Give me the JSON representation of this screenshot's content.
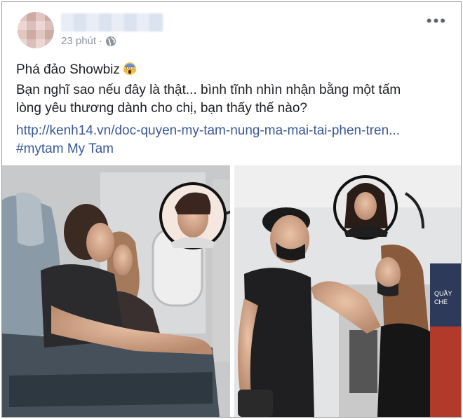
{
  "post": {
    "time": "23 phút",
    "separator": "·",
    "line1": "Phá đảo Showbiz",
    "line2": "Bạn nghĩ sao nếu đây là thật... bình tĩnh nhìn nhận bằng một tấm",
    "line3": "lòng yêu thương dành cho chị, bạn thấy thế nào?",
    "link": "http://kenh14.vn/doc-quyen-my-tam-nung-ma-mai-tai-phen-tren...",
    "hashtags": "#mytam My Tam"
  },
  "photo": {
    "sign_text": "QUẦY",
    "sign_text2": "CHE"
  },
  "colors": {
    "link": "#385898",
    "text": "#1c1e21",
    "meta": "#8d949e"
  }
}
